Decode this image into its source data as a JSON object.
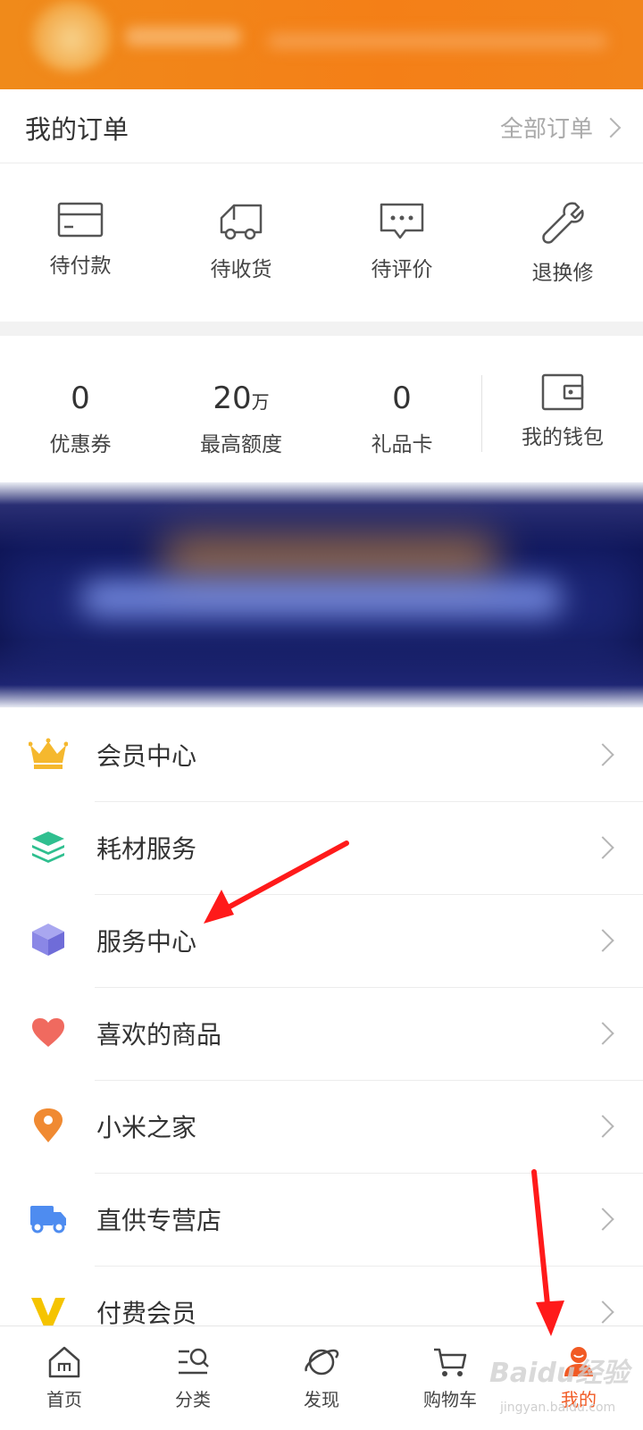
{
  "orders": {
    "title": "我的订单",
    "all_label": "全部订单",
    "items": [
      {
        "label": "待付款",
        "icon": "card-icon"
      },
      {
        "label": "待收货",
        "icon": "truck-icon"
      },
      {
        "label": "待评价",
        "icon": "chat-bubble-icon"
      },
      {
        "label": "退换修",
        "icon": "wrench-icon"
      }
    ]
  },
  "wallet": {
    "items": [
      {
        "value": "0",
        "label": "优惠券"
      },
      {
        "value": "20",
        "unit": "万",
        "label": "最高额度"
      },
      {
        "value": "0",
        "label": "礼品卡"
      }
    ],
    "wallet_label": "我的钱包",
    "wallet_icon": "wallet-icon"
  },
  "menu": [
    {
      "label": "会员中心",
      "icon": "crown-icon",
      "color": "#f5b82e"
    },
    {
      "label": "耗材服务",
      "icon": "layers-icon",
      "color": "#2fbf8f"
    },
    {
      "label": "服务中心",
      "icon": "cube-icon",
      "color": "#8a87e6"
    },
    {
      "label": "喜欢的商品",
      "icon": "heart-icon",
      "color": "#f06a5f"
    },
    {
      "label": "小米之家",
      "icon": "location-pin-icon",
      "color": "#f08a32"
    },
    {
      "label": "直供专营店",
      "icon": "delivery-truck-icon",
      "color": "#4e8cf0"
    },
    {
      "label": "付费会员",
      "icon": "v-badge-icon",
      "color": "#f5c400"
    }
  ],
  "nav": [
    {
      "label": "首页",
      "icon": "home-icon"
    },
    {
      "label": "分类",
      "icon": "category-search-icon"
    },
    {
      "label": "发现",
      "icon": "planet-icon"
    },
    {
      "label": "购物车",
      "icon": "cart-icon"
    },
    {
      "label": "我的",
      "icon": "profile-icon",
      "active": true
    }
  ],
  "colors": {
    "header_orange": "#f2841b",
    "active_nav": "#f15a24",
    "annotation_arrow": "#ff1a1a"
  },
  "watermark": {
    "text": "Baidu经验",
    "sub": "jingyan.baidu.com"
  }
}
